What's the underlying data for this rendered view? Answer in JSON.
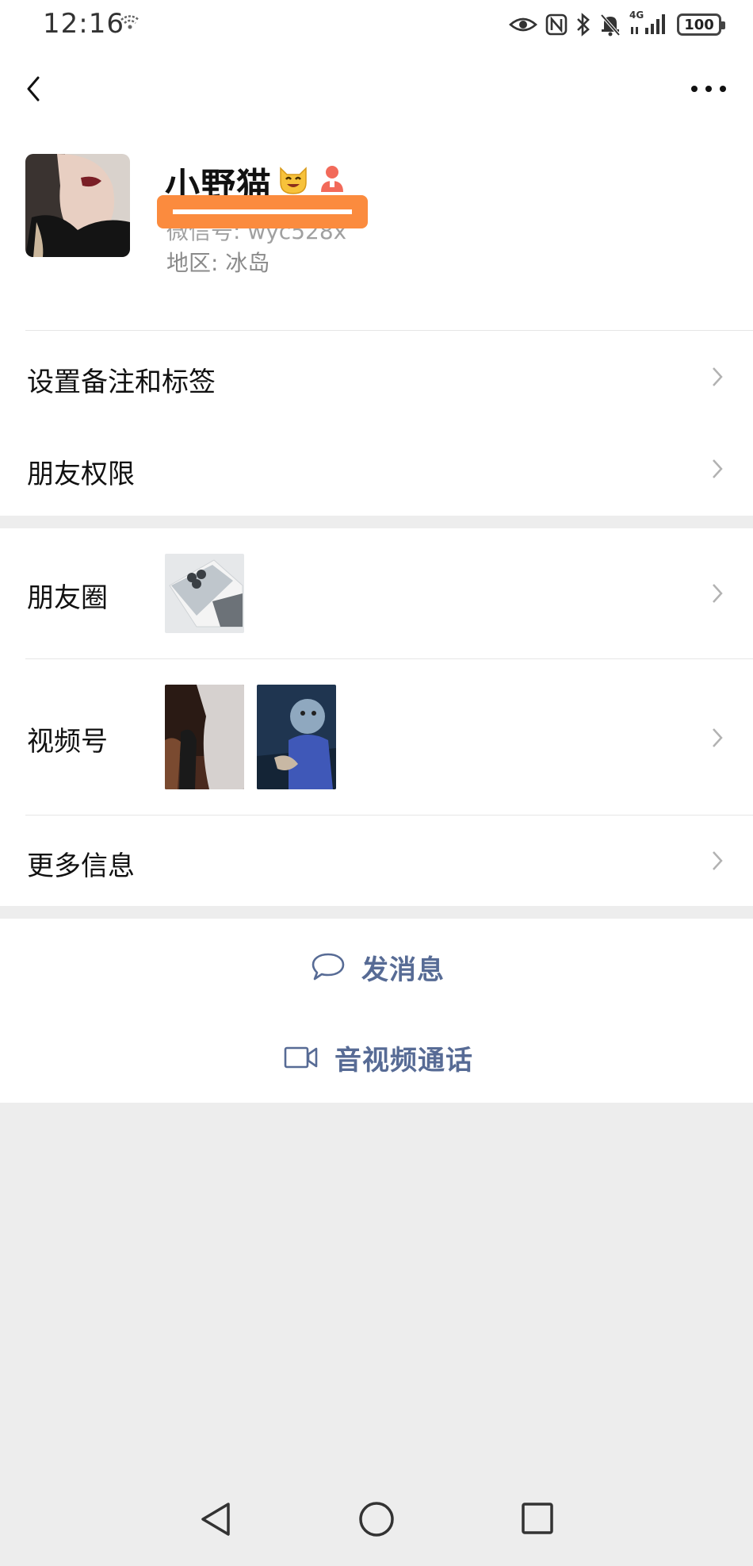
{
  "status_bar": {
    "time": "12:16",
    "battery": "100",
    "network_label": "4G"
  },
  "profile": {
    "nickname": "小野猫",
    "wechat_id_text": "微信号: wyc528x",
    "region_text": "地区: 冰岛"
  },
  "menu": {
    "remarks_tags": "设置备注和标签",
    "friend_permissions": "朋友权限",
    "moments": "朋友圈",
    "channels": "视频号",
    "more_info": "更多信息"
  },
  "actions": {
    "send_message": "发消息",
    "video_call": "音视频通话"
  },
  "colors": {
    "link_blue": "#576b95",
    "background_gray": "#ededed",
    "redaction_orange": "#fb8b3e"
  },
  "icons": {
    "back": "chevron-left-icon",
    "more": "more-dots-icon",
    "chevron": "chevron-right-icon",
    "chat": "chat-bubble-icon",
    "video": "video-camera-icon"
  }
}
